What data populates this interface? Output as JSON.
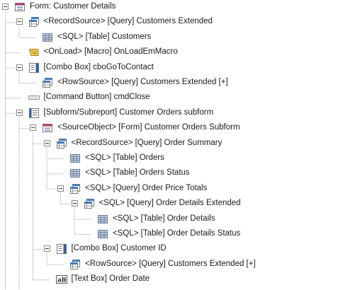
{
  "tree": [
    {
      "label": "Form: Customer Details",
      "depth": 0,
      "icon": "form-icon",
      "expanded": true
    },
    {
      "label": "<RecordSource> [Query] Customers Extended",
      "depth": 1,
      "icon": "query-icon",
      "expanded": true
    },
    {
      "label": "<SQL> [Table] Customers",
      "depth": 2,
      "icon": "table-icon",
      "expanded": null
    },
    {
      "label": "<OnLoad> [Macro] OnLoadEmMacro",
      "depth": 1,
      "icon": "macro-icon",
      "expanded": null
    },
    {
      "label": "[Combo Box] cboGoToContact",
      "depth": 1,
      "icon": "combo-box-icon",
      "expanded": true
    },
    {
      "label": "<RowSource> [Query] Customers Extended [+]",
      "depth": 2,
      "icon": "query-icon",
      "expanded": null
    },
    {
      "label": "[Command Button] cmdClose",
      "depth": 1,
      "icon": "command-button-icon",
      "expanded": null
    },
    {
      "label": "[Subform/Subreport] Customer Orders subform",
      "depth": 1,
      "icon": "subform-icon",
      "expanded": true
    },
    {
      "label": "<SourceObject> [Form] Customer Orders Subform",
      "depth": 2,
      "icon": "form-icon",
      "expanded": true
    },
    {
      "label": "<RecordSource> [Query] Order Summary",
      "depth": 3,
      "icon": "query-icon",
      "expanded": true
    },
    {
      "label": "<SQL> [Table] Orders",
      "depth": 4,
      "icon": "table-icon",
      "expanded": null
    },
    {
      "label": "<SQL> [Table] Orders Status",
      "depth": 4,
      "icon": "table-icon",
      "expanded": null
    },
    {
      "label": "<SQL> [Query] Order Price Totals",
      "depth": 4,
      "icon": "query-icon",
      "expanded": true
    },
    {
      "label": "<SQL> [Query] Order Details Extended",
      "depth": 5,
      "icon": "query-icon",
      "expanded": true
    },
    {
      "label": "<SQL> [Table] Order Details",
      "depth": 6,
      "icon": "table-icon",
      "expanded": null
    },
    {
      "label": "<SQL> [Table] Order Details Status",
      "depth": 6,
      "icon": "table-icon",
      "expanded": null
    },
    {
      "label": "[Combo Box] Customer ID",
      "depth": 3,
      "icon": "combo-box-icon",
      "expanded": true
    },
    {
      "label": "<RowSource> [Query] Customers Extended [+]",
      "depth": 4,
      "icon": "query-icon",
      "expanded": null
    },
    {
      "label": "[Text Box] Order Date",
      "depth": 3,
      "icon": "text-box-icon",
      "expanded": null
    }
  ],
  "colors": {
    "line": "#a0a0a0",
    "toggle_border": "#8a8a8a",
    "form_header": "#b0406a",
    "query_header": "#3a7cc4",
    "table_cell": "#c9d7ea",
    "macro": "#e8c84a"
  }
}
